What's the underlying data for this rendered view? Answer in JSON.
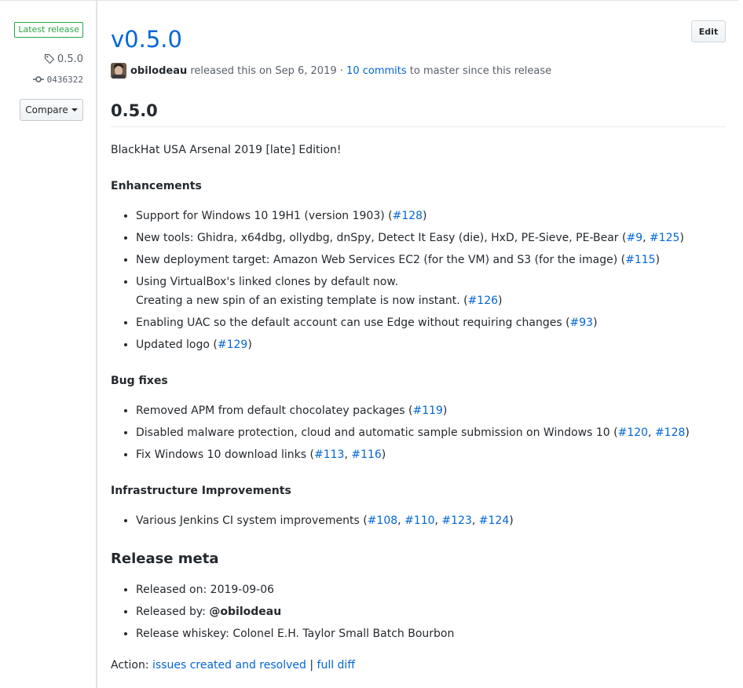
{
  "sidebar": {
    "latest_label": "Latest release",
    "tag": "0.5.0",
    "commit": "0436322",
    "compare_label": "Compare"
  },
  "header": {
    "title": "v0.5.0",
    "edit_label": "Edit",
    "author": "obilodeau",
    "released_text": "released this on",
    "date": "Sep 6, 2019",
    "dot": "·",
    "commits_link": "10 commits",
    "commits_suffix": "to master since this release"
  },
  "body": {
    "heading": "0.5.0",
    "intro": "BlackHat USA Arsenal 2019 [late] Edition!",
    "enhancements": {
      "title": "Enhancements",
      "items": [
        {
          "pre": "Support for Windows 10 19H1 (version 1903) (",
          "links": [
            "#128"
          ],
          "post": ")"
        },
        {
          "pre": "New tools: Ghidra, x64dbg, ollydbg, dnSpy, Detect It Easy (die), HxD, PE-Sieve, PE-Bear (",
          "links": [
            "#9",
            "#125"
          ],
          "post": ")"
        },
        {
          "pre": "New deployment target: Amazon Web Services EC2 (for the VM) and S3 (for the image) (",
          "links": [
            "#115"
          ],
          "post": ")"
        },
        {
          "line1": "Using VirtualBox's linked clones by default now.",
          "pre": "Creating a new spin of an existing template is now instant. (",
          "links": [
            "#126"
          ],
          "post": ")"
        },
        {
          "pre": "Enabling UAC so the default account can use Edge without requiring changes (",
          "links": [
            "#93"
          ],
          "post": ")"
        },
        {
          "pre": "Updated logo (",
          "links": [
            "#129"
          ],
          "post": ")"
        }
      ]
    },
    "bugfixes": {
      "title": "Bug fixes",
      "items": [
        {
          "pre": "Removed APM from default chocolatey packages (",
          "links": [
            "#119"
          ],
          "post": ")"
        },
        {
          "pre": "Disabled malware protection, cloud and automatic sample submission on Windows 10 (",
          "links": [
            "#120",
            "#128"
          ],
          "post": ")"
        },
        {
          "pre": "Fix Windows 10 download links (",
          "links": [
            "#113",
            "#116"
          ],
          "post": ")"
        }
      ]
    },
    "infra": {
      "title": "Infrastructure Improvements",
      "items": [
        {
          "pre": "Various Jenkins CI system improvements (",
          "links": [
            "#108",
            "#110",
            "#123",
            "#124"
          ],
          "post": ")"
        }
      ]
    },
    "meta": {
      "title": "Release meta",
      "released_on_label": "Released on:",
      "released_on_value": "2019-09-06",
      "released_by_label": "Released by:",
      "released_by_value": "@obilodeau",
      "whiskey_label": "Release whiskey:",
      "whiskey_value": "Colonel E.H. Taylor Small Batch Bourbon"
    },
    "action": {
      "label": "Action:",
      "link1": "issues created and resolved",
      "separator": "|",
      "link2": "full diff"
    }
  },
  "colors": {
    "link": "#0366d6",
    "badge_green": "#28a745",
    "text": "#24292e",
    "muted": "#586069"
  }
}
